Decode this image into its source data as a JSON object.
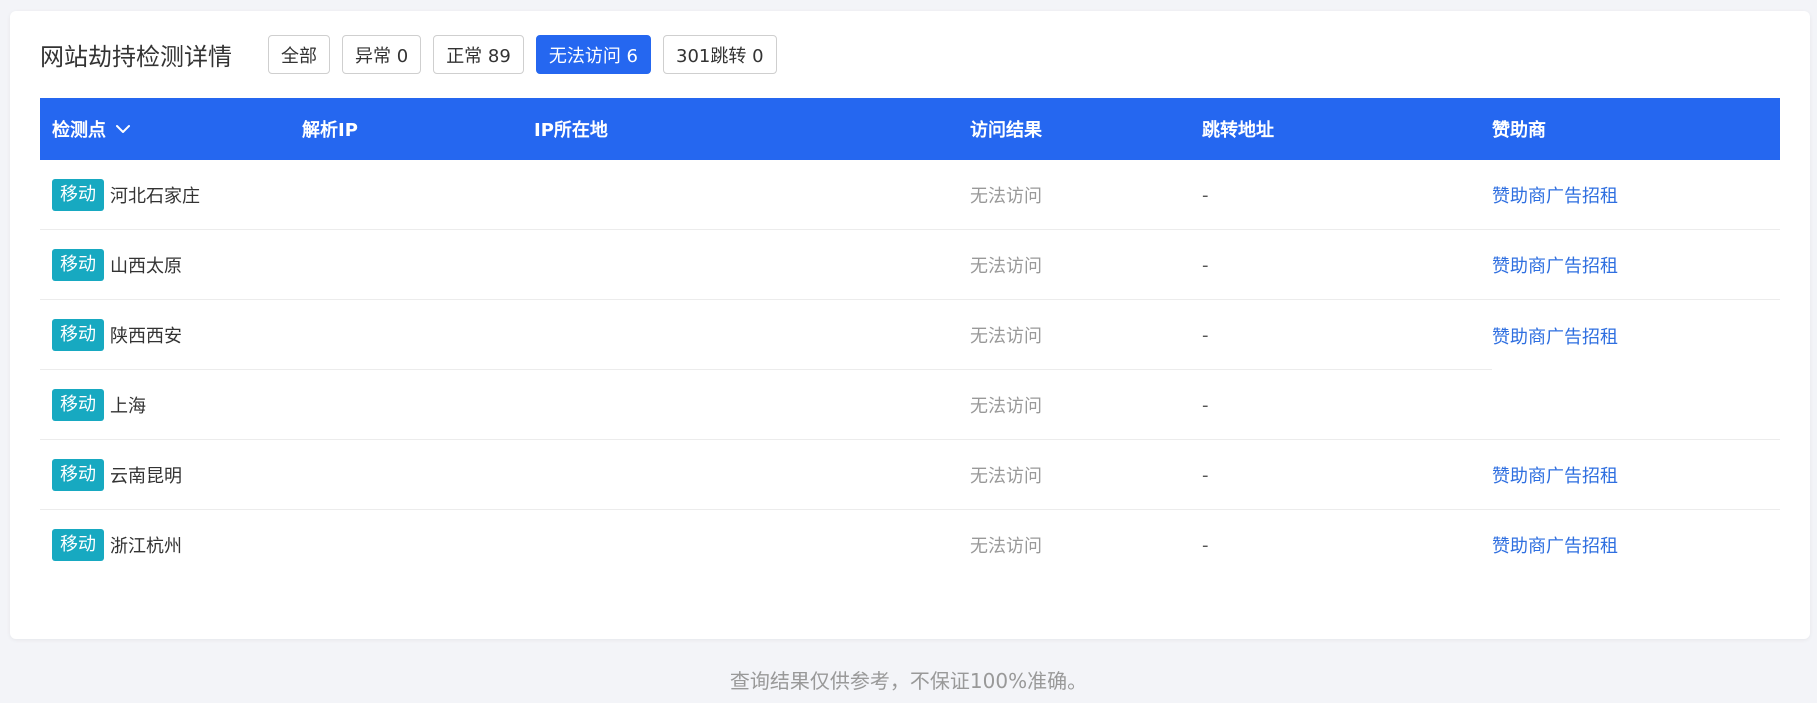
{
  "header": {
    "title": "网站劫持检测详情",
    "filters": [
      {
        "label": "全部",
        "active": false
      },
      {
        "label": "异常 0",
        "active": false
      },
      {
        "label": "正常 89",
        "active": false
      },
      {
        "label": "无法访问 6",
        "active": true
      },
      {
        "label": "301跳转 0",
        "active": false
      }
    ]
  },
  "table": {
    "columns": [
      "检测点",
      "解析IP",
      "IP所在地",
      "访问结果",
      "跳转地址",
      "赞助商"
    ],
    "sort_icon": "chevron-down-icon",
    "rows": [
      {
        "isp": "移动",
        "location": "河北石家庄",
        "ip": "",
        "ip_location": "",
        "result": "无法访问",
        "redirect": "-",
        "sponsor": "赞助商广告招租"
      },
      {
        "isp": "移动",
        "location": "山西太原",
        "ip": "",
        "ip_location": "",
        "result": "无法访问",
        "redirect": "-",
        "sponsor": "赞助商广告招租"
      },
      {
        "isp": "移动",
        "location": "陕西西安",
        "ip": "",
        "ip_location": "",
        "result": "无法访问",
        "redirect": "-",
        "sponsor": "赞助商广告招租"
      },
      {
        "isp": "移动",
        "location": "上海",
        "ip": "",
        "ip_location": "",
        "result": "无法访问",
        "redirect": "-",
        "sponsor": ""
      },
      {
        "isp": "移动",
        "location": "云南昆明",
        "ip": "",
        "ip_location": "",
        "result": "无法访问",
        "redirect": "-",
        "sponsor": "赞助商广告招租"
      },
      {
        "isp": "移动",
        "location": "浙江杭州",
        "ip": "",
        "ip_location": "",
        "result": "无法访问",
        "redirect": "-",
        "sponsor": "赞助商广告招租"
      }
    ]
  },
  "footer": {
    "note": "查询结果仅供参考，不保证100%准确。"
  },
  "colors": {
    "accent": "#2567f0",
    "isp_tag": "#17a9c1",
    "sponsor_link": "#2f6fe0",
    "muted_text": "#999999"
  }
}
